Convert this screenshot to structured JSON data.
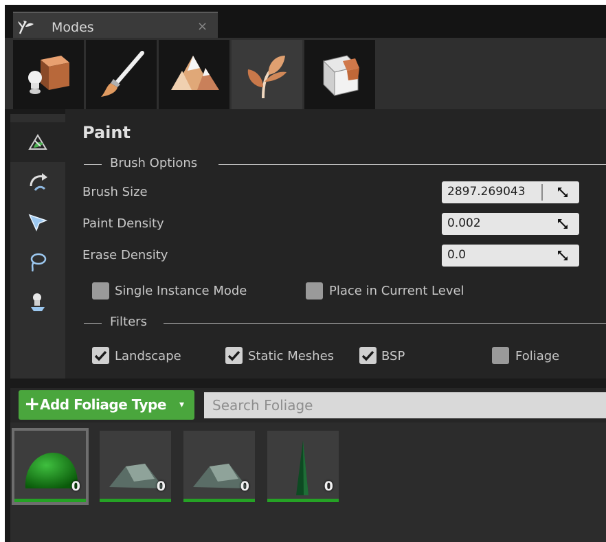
{
  "tab": {
    "title": "Modes",
    "close": "×"
  },
  "modes": [
    {
      "name": "place",
      "icon": "place-mode-icon"
    },
    {
      "name": "paint",
      "icon": "paint-brush-icon"
    },
    {
      "name": "landscape",
      "icon": "landscape-icon"
    },
    {
      "name": "foliage",
      "icon": "foliage-leaf-icon"
    },
    {
      "name": "geometry",
      "icon": "geometry-cube-icon"
    }
  ],
  "tools": [
    {
      "name": "paint",
      "icon": "paint-tool-icon"
    },
    {
      "name": "reapply",
      "icon": "reapply-tool-icon"
    },
    {
      "name": "select",
      "icon": "select-tool-icon"
    },
    {
      "name": "lasso",
      "icon": "lasso-tool-icon"
    },
    {
      "name": "fill",
      "icon": "fill-tool-icon"
    }
  ],
  "panel": {
    "title": "Paint",
    "brush_section": "Brush Options",
    "brush_size_label": "Brush Size",
    "brush_size_value": "2897.269043",
    "paint_density_label": "Paint Density",
    "paint_density_value": "0.002",
    "erase_density_label": "Erase Density",
    "erase_density_value": "0.0",
    "single_instance_label": "Single Instance Mode",
    "single_instance_checked": false,
    "place_current_label": "Place in Current Level",
    "place_current_checked": false,
    "filters_section": "Filters",
    "filters": [
      {
        "label": "Landscape",
        "checked": true
      },
      {
        "label": "Static Meshes",
        "checked": true
      },
      {
        "label": "BSP",
        "checked": true
      },
      {
        "label": "Foliage",
        "checked": false
      }
    ]
  },
  "foliage": {
    "add_label": "Add Foliage Type",
    "add_plus": "+",
    "add_caret": "▾",
    "search_placeholder": "Search Foliage",
    "tiles": [
      {
        "shape": "dome",
        "count": "0",
        "selected": true
      },
      {
        "shape": "rock",
        "count": "0",
        "selected": false
      },
      {
        "shape": "rock",
        "count": "0",
        "selected": false
      },
      {
        "shape": "cone",
        "count": "0",
        "selected": false
      }
    ]
  },
  "colors": {
    "accent_green": "#4aa63d",
    "bar_green": "#25a225"
  }
}
